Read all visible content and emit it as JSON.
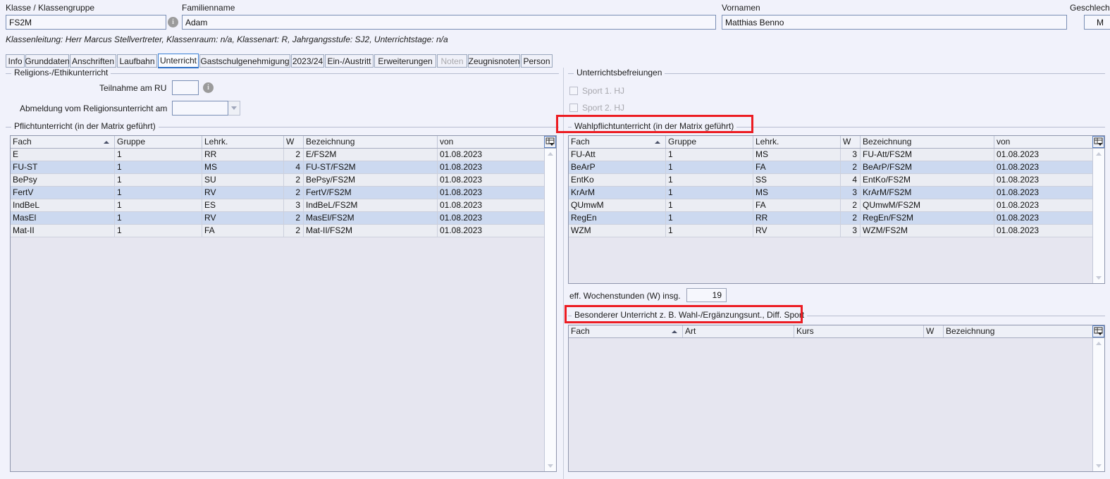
{
  "header": {
    "fields": [
      {
        "label": "Klasse / Klassengruppe",
        "value": "FS2M"
      },
      {
        "label": "Familienname",
        "value": "Adam"
      },
      {
        "label": "Vornamen",
        "value": "Matthias Benno"
      },
      {
        "label": "Geschlecht",
        "value": "M"
      }
    ],
    "info_icon": "i",
    "subtitle": "Klassenleitung: Herr Marcus Stellvertreter, Klassenraum: n/a, Klassenart: R, Jahrgangsstufe: SJ2, Unterrichtstage: n/a"
  },
  "tabs": [
    {
      "label": "Info",
      "active": false,
      "disabled": false
    },
    {
      "label": "Grunddaten",
      "active": false,
      "disabled": false
    },
    {
      "label": "Anschriften",
      "active": false,
      "disabled": false
    },
    {
      "label": "Laufbahn",
      "active": false,
      "disabled": false
    },
    {
      "label": "Unterricht",
      "active": true,
      "disabled": false
    },
    {
      "label": "Gastschulgenehmigung",
      "active": false,
      "disabled": false
    },
    {
      "label": "2023/24",
      "active": false,
      "disabled": false
    },
    {
      "label": "Ein-/Austritt",
      "active": false,
      "disabled": false
    },
    {
      "label": "Erweiterungen",
      "active": false,
      "disabled": false
    },
    {
      "label": "Noten",
      "active": false,
      "disabled": true
    },
    {
      "label": "Zeugnisnoten",
      "active": false,
      "disabled": false
    },
    {
      "label": "Person",
      "active": false,
      "disabled": false
    }
  ],
  "religion_group": {
    "title": "Religions-/Ethikunterricht",
    "teilnahme_label": "Teilnahme am RU",
    "teilnahme_value": "",
    "abmeldung_label": "Abmeldung vom Religionsunterricht am",
    "abmeldung_value": ""
  },
  "befreiungen_group": {
    "title": "Unterrichtsbefreiungen",
    "items": [
      {
        "label": "Sport 1. HJ",
        "checked": false
      },
      {
        "label": "Sport 2. HJ",
        "checked": false
      }
    ]
  },
  "pflicht_group": {
    "title": "Pflichtunterricht (in der Matrix geführt)",
    "columns": [
      "Fach",
      "Gruppe",
      "Lehrk.",
      "W",
      "Bezeichnung",
      "von"
    ],
    "sort_column": "Fach",
    "sort_direction": "asc",
    "rows": [
      [
        "E",
        "1",
        "RR",
        "2",
        "E/FS2M",
        "01.08.2023"
      ],
      [
        "FU-ST",
        "1",
        "MS",
        "4",
        "FU-ST/FS2M",
        "01.08.2023"
      ],
      [
        "BePsy",
        "1",
        "SU",
        "2",
        "BePsy/FS2M",
        "01.08.2023"
      ],
      [
        "FertV",
        "1",
        "RV",
        "2",
        "FertV/FS2M",
        "01.08.2023"
      ],
      [
        "IndBeL",
        "1",
        "ES",
        "3",
        "IndBeL/FS2M",
        "01.08.2023"
      ],
      [
        "MasEl",
        "1",
        "RV",
        "2",
        "MasEl/FS2M",
        "01.08.2023"
      ],
      [
        "Mat-II",
        "1",
        "FA",
        "2",
        "Mat-II/FS2M",
        "01.08.2023"
      ]
    ]
  },
  "wahl_group": {
    "title": "Wahlpflichtunterricht (in der Matrix geführt)",
    "highlighted": true,
    "columns": [
      "Fach",
      "Gruppe",
      "Lehrk.",
      "W",
      "Bezeichnung",
      "von"
    ],
    "sort_column": "Fach",
    "sort_direction": "asc",
    "rows": [
      [
        "FU-Att",
        "1",
        "MS",
        "3",
        "FU-Att/FS2M",
        "01.08.2023"
      ],
      [
        "BeArP",
        "1",
        "FA",
        "2",
        "BeArP/FS2M",
        "01.08.2023"
      ],
      [
        "EntKo",
        "1",
        "SS",
        "4",
        "EntKo/FS2M",
        "01.08.2023"
      ],
      [
        "KrArM",
        "1",
        "MS",
        "3",
        "KrArM/FS2M",
        "01.08.2023"
      ],
      [
        "QUmwM",
        "1",
        "FA",
        "2",
        "QUmwM/FS2M",
        "01.08.2023"
      ],
      [
        "RegEn",
        "1",
        "RR",
        "2",
        "RegEn/FS2M",
        "01.08.2023"
      ],
      [
        "WZM",
        "1",
        "RV",
        "3",
        "WZM/FS2M",
        "01.08.2023"
      ]
    ]
  },
  "wochenstunden": {
    "label": "eff. Wochenstunden (W) insg.",
    "value": "19"
  },
  "besonderer_group": {
    "title": "Besonderer Unterricht z. B. Wahl-/Ergänzungsunt., Diff. Sport",
    "highlighted": true,
    "columns": [
      "Fach",
      "Art",
      "Kurs",
      "W",
      "Bezeichnung"
    ],
    "sort_column": "Fach",
    "sort_direction": "asc",
    "rows": []
  },
  "colors": {
    "background": "#f1f2fb",
    "row_even": "#ebedf3",
    "row_odd": "#ccd9f0",
    "grid_empty": "#e6e6f0",
    "accent": "#2f6fc4",
    "annotation": "#ec1c22"
  }
}
